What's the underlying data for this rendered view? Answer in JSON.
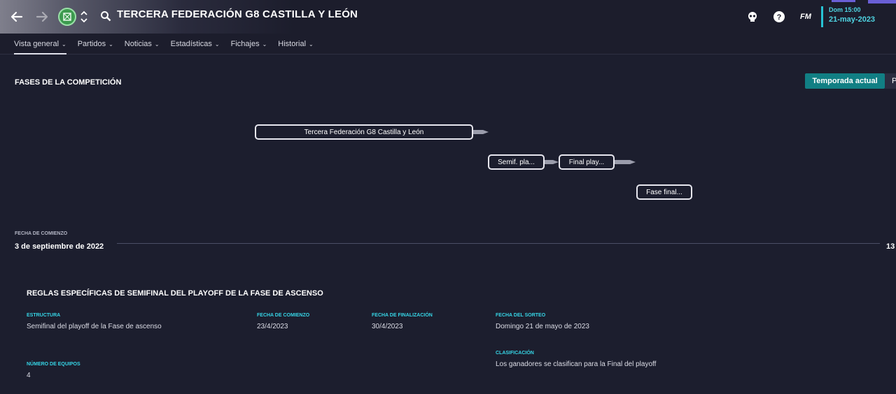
{
  "header": {
    "title": "TERCERA FEDERACIÓN G8 CASTILLA Y LEÓN",
    "date_line1": "Dom 15:00",
    "date_line2": "21-may-2023",
    "fm_label": "FM",
    "icons": [
      "back-arrow-icon",
      "forward-arrow-icon",
      "competition-badge-icon",
      "up-down-icon",
      "search-icon",
      "skull-icon",
      "help-icon"
    ]
  },
  "nav": {
    "items": [
      {
        "label": "Vista general"
      },
      {
        "label": "Partidos"
      },
      {
        "label": "Noticias"
      },
      {
        "label": "Estadísticas"
      },
      {
        "label": "Fichajes"
      },
      {
        "label": "Historial"
      }
    ],
    "active_index": 0
  },
  "phases": {
    "title": "FASES DE LA COMPETICIÓN",
    "season_button": "Temporada actual",
    "season_button_next": "P",
    "stages": [
      {
        "label": "Tercera Federación G8 Castilla y León"
      },
      {
        "label": "Semif. pla..."
      },
      {
        "label": "Final play..."
      },
      {
        "label": "Fase final..."
      }
    ]
  },
  "timeline": {
    "label": "FECHA DE COMIENZO",
    "start_date": "3 de septiembre de 2022",
    "end_date_partial": "13"
  },
  "rules": {
    "title": "REGLAS ESPECÍFICAS DE SEMIFINAL DEL PLAYOFF DE LA FASE DE ASCENSO",
    "estructura_label": "ESTRUCTURA",
    "estructura_value": "Semifinal del playoff de la Fase de ascenso",
    "fecha_comienzo_label": "FECHA DE COMIENZO",
    "fecha_comienzo_value": "23/4/2023",
    "fecha_finalizacion_label": "FECHA DE FINALIZACIÓN",
    "fecha_finalizacion_value": "30/4/2023",
    "fecha_sorteo_label": "FECHA DEL SORTEO",
    "fecha_sorteo_value": "Domingo 21 de mayo de 2023",
    "clasificacion_label": "CLASIFICACIÓN",
    "clasificacion_value": "Los ganadores se clasifican para la Final del playoff",
    "num_equipos_label": "NÚMERO DE EQUIPOS",
    "num_equipos_value": "4"
  },
  "colors": {
    "accent": "#27c3d4",
    "button_teal": "#117f84",
    "background": "#1c1e2e"
  }
}
